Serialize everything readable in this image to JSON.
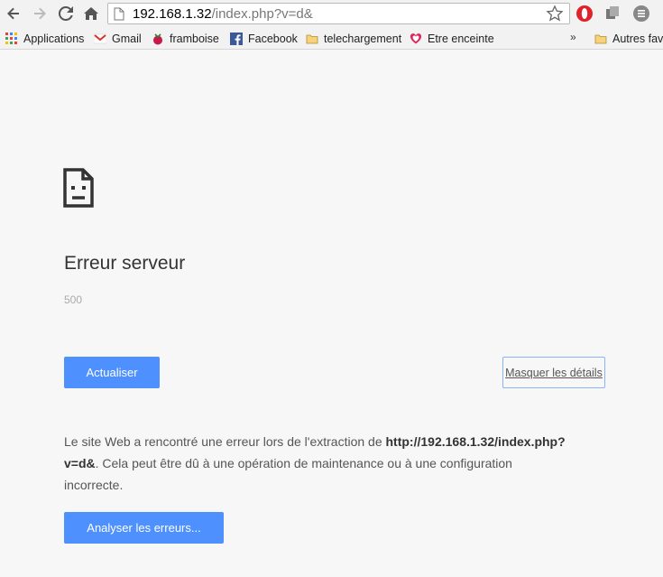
{
  "toolbar": {
    "url_host": "192.168.1.32",
    "url_path": "/index.php?v=d&"
  },
  "bookmarks": [
    {
      "label": "Applications",
      "icon": "apps-grid-icon"
    },
    {
      "label": "Gmail",
      "icon": "gmail-icon"
    },
    {
      "label": "framboise",
      "icon": "raspberry-icon"
    },
    {
      "label": "Facebook",
      "icon": "facebook-icon"
    },
    {
      "label": "telechargement",
      "icon": "folder-icon"
    },
    {
      "label": "Etre enceinte",
      "icon": "heart-icon"
    },
    {
      "label": "Autres favoris",
      "icon": "folder-icon"
    }
  ],
  "error": {
    "title": "Erreur serveur",
    "code": "500",
    "reload_label": "Actualiser",
    "details_label": "Masquer les détails",
    "desc_before": "Le site Web a rencontré une erreur lors de l'extraction de ",
    "desc_url": "http://192.168.1.32/index.php?v=d&",
    "desc_after": ". Cela peut être dû à une opération de maintenance ou à une configuration incorrecte.",
    "diagnose_label": "Analyser les erreurs..."
  },
  "colors": {
    "accent": "#4d90fe",
    "page_bg": "#f7f7f7"
  }
}
